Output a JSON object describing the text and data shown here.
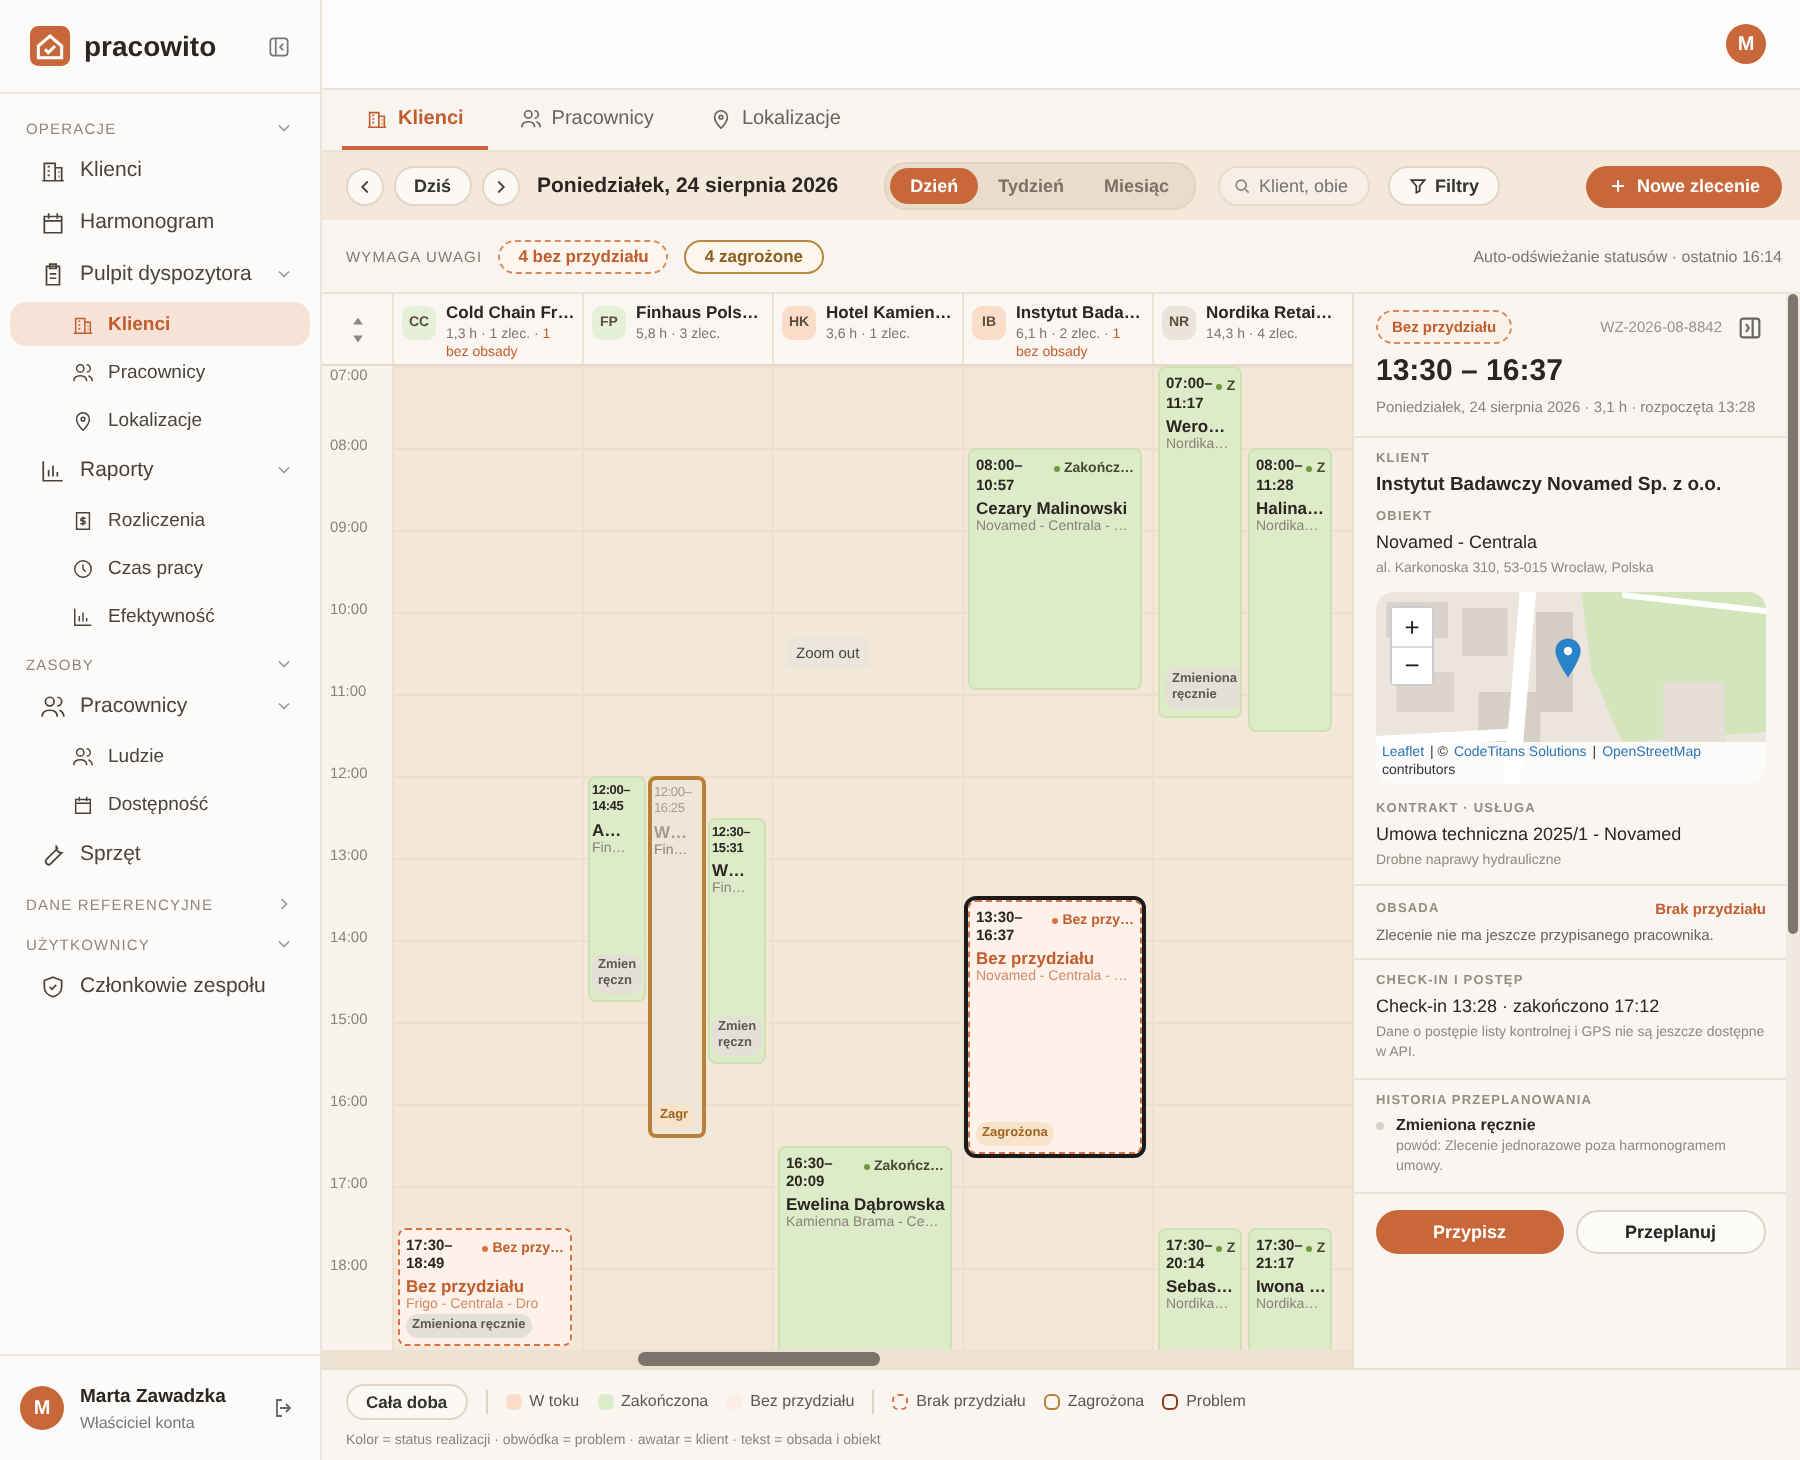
{
  "sidebar": {
    "logo": "pracowito",
    "sections": [
      {
        "title": "OPERACJE",
        "expanded": true,
        "items": [
          {
            "label": "Klienci",
            "kind": "building",
            "selected": false
          },
          {
            "label": "Harmonogram",
            "kind": "calendar",
            "selected": false
          },
          {
            "label": "Pulpit dyspozytora",
            "kind": "clipboard",
            "selected": false,
            "expanded": true,
            "children": [
              {
                "label": "Klienci",
                "kind": "building",
                "selected": true
              },
              {
                "label": "Pracownicy",
                "kind": "users",
                "selected": false
              },
              {
                "label": "Lokalizacje",
                "kind": "pin",
                "selected": false
              }
            ]
          },
          {
            "label": "Raporty",
            "kind": "chart",
            "selected": false,
            "expanded": true,
            "children": [
              {
                "label": "Rozliczenia",
                "kind": "invoice",
                "selected": false
              },
              {
                "label": "Czas pracy",
                "kind": "clock",
                "selected": false
              },
              {
                "label": "Efektywność",
                "kind": "chart",
                "selected": false
              }
            ]
          }
        ]
      },
      {
        "title": "ZASOBY",
        "expanded": true,
        "items": [
          {
            "label": "Pracownicy",
            "kind": "users",
            "selected": false,
            "expanded": true,
            "children": [
              {
                "label": "Ludzie",
                "kind": "users",
                "selected": false
              },
              {
                "label": "Dostępność",
                "kind": "calendar",
                "selected": false
              }
            ]
          },
          {
            "label": "Sprzęt",
            "kind": "wrench",
            "selected": false
          }
        ]
      },
      {
        "title": "DANE REFERENCYJNE",
        "expanded": false
      },
      {
        "title": "UŻYTKOWNICY",
        "expanded": true,
        "items": [
          {
            "label": "Członkowie zespołu",
            "kind": "shield",
            "selected": false
          }
        ]
      }
    ],
    "user": {
      "initial": "M",
      "name": "Marta Zawadzka",
      "role": "Właściciel konta"
    }
  },
  "topbar": {
    "avatar": "M"
  },
  "tabs": [
    {
      "label": "Klienci",
      "kind": "building",
      "selected": true
    },
    {
      "label": "Pracownicy",
      "kind": "users",
      "selected": false
    },
    {
      "label": "Lokalizacje",
      "kind": "pin",
      "selected": false
    }
  ],
  "toolbar": {
    "today": "Dziś",
    "date": "Poniedziałek, 24 sierpnia 2026",
    "views": [
      {
        "label": "Dzień",
        "selected": true
      },
      {
        "label": "Tydzień",
        "selected": false
      },
      {
        "label": "Miesiąc",
        "selected": false
      }
    ],
    "search": {
      "placeholder": "Klient, obie"
    },
    "filters": "Filtry",
    "new_order": "Nowe zlecenie"
  },
  "attention": {
    "label": "WYMAGA UWAGI",
    "chips": [
      {
        "label": "4 bez przydziału",
        "kind": "unassigned"
      },
      {
        "label": "4 zagrożone",
        "kind": "risk"
      }
    ],
    "refresh": "Auto-odświeżanie statusów · ostatnio 16:14"
  },
  "calendar": {
    "hours": [
      "07:00",
      "08:00",
      "09:00",
      "10:00",
      "11:00",
      "12:00",
      "13:00",
      "14:00",
      "15:00",
      "16:00",
      "17:00",
      "18:00"
    ],
    "tooltip": "Zoom out",
    "columns": [
      {
        "initials": "CC",
        "color": "#e6f0d6",
        "name": "Cold Chain Fr…",
        "meta": "1,3 h · 1 zlec. · ",
        "warning": "1 bez obsady",
        "events": [
          {
            "from": "17:30–",
            "to": "18:49",
            "kind": "unassigned",
            "selected": false,
            "tag": "Bez przy…",
            "title": "Bez przydziału",
            "sub": "Frigo - Centrala - Dro",
            "pill": {
              "label": "Zmieniona ręcznie",
              "kind": "manual"
            }
          }
        ]
      },
      {
        "initials": "FP",
        "color": "#e6f0d6",
        "name": "Finhaus Pols…",
        "meta": "5,8 h · 3 zlec.",
        "events": [
          {
            "from": "12:00–",
            "to": "14:45",
            "kind": "done",
            "selected": false,
            "title": "A…",
            "sub": "Fin…",
            "pill": {
              "label": "Zmien ręczn",
              "kind": "manual"
            }
          },
          {
            "from": "12:00–",
            "to": "16:25",
            "kind": "risk",
            "selected": false,
            "title": "W…",
            "sub": "Fin…",
            "pill": {
              "label": "Zagr",
              "kind": "risk"
            }
          },
          {
            "from": "12:30–",
            "to": "15:31",
            "kind": "done",
            "selected": false,
            "title": "W…",
            "sub": "Fin…",
            "pill": {
              "label": "Zmien ręczn",
              "kind": "manual"
            }
          }
        ]
      },
      {
        "initials": "HK",
        "color": "#fbdcc9",
        "name": "Hotel Kamien…",
        "meta": "3,6 h · 1 zlec.",
        "events": [
          {
            "from": "16:30–",
            "to": "20:09",
            "kind": "done",
            "selected": false,
            "tag": "Zakończ…",
            "title": "Ewelina Dąbrowska",
            "sub": "Kamienna Brama - Ce…"
          }
        ]
      },
      {
        "initials": "IB",
        "color": "#fbdcc9",
        "name": "Instytut Bada…",
        "meta": "6,1 h · 2 zlec. · ",
        "warning": "1 bez obsady",
        "events": [
          {
            "from": "08:00–",
            "to": "10:57",
            "kind": "done",
            "selected": false,
            "tag": "Zakończ…",
            "title": "Cezary Malinowski",
            "sub": "Novamed - Centrala - …"
          },
          {
            "from": "13:30–",
            "to": "16:37",
            "kind": "unassigned",
            "selected": true,
            "tag": "Bez przy…",
            "title": "Bez przydziału",
            "sub": "Novamed - Centrala - …",
            "pill": {
              "label": "Zagrożona",
              "kind": "risk"
            }
          }
        ]
      },
      {
        "initials": "NR",
        "color": "#ebe4da",
        "name": "Nordika Retai…",
        "meta": "14,3 h · 4 zlec.",
        "events": [
          {
            "from": "07:00–",
            "to": "11:17",
            "kind": "done",
            "selected": false,
            "tag": "Z",
            "title": "Wero…",
            "sub": "Nordika…",
            "pill": {
              "label": "Zmieniona ręcznie",
              "kind": "manual"
            }
          },
          {
            "from": "08:00–",
            "to": "11:28",
            "kind": "done",
            "selected": false,
            "tag": "Z",
            "title": "Halina…",
            "sub": "Nordika…"
          },
          {
            "from": "17:30–",
            "to": "20:14",
            "kind": "done",
            "selected": false,
            "tag": "Z",
            "title": "Sebas…",
            "sub": "Nordika…"
          },
          {
            "from": "17:30–",
            "to": "21:17",
            "kind": "done",
            "selected": false,
            "tag": "Z",
            "title": "Iwona …",
            "sub": "Nordika…"
          }
        ]
      }
    ]
  },
  "detail": {
    "status_chip": "Bez przydziału",
    "id": "WZ-2026-08-8842",
    "time": "13:30 – 16:37",
    "subtitle": "Poniedziałek, 24 sierpnia 2026 · 3,1 h · rozpoczęta 13:28",
    "client": {
      "label": "KLIENT",
      "value": "Instytut Badawczy Novamed Sp. z o.o."
    },
    "object": {
      "label": "OBIEKT",
      "value": "Novamed - Centrala",
      "address": "al. Karkonoska 310, 53-015 Wrocław, Polska"
    },
    "map": {
      "zoom_in": "+",
      "zoom_out": "−",
      "attribution": [
        {
          "text": "Leaflet",
          "link": true
        },
        {
          "text": "| ©",
          "link": false
        },
        {
          "text": "CodeTitans Solutions",
          "link": true
        },
        {
          "text": "|",
          "link": false
        },
        {
          "text": "OpenStreetMap",
          "link": true
        },
        {
          "text": "contributors",
          "link": false
        }
      ]
    },
    "contract": {
      "label": "KONTRAKT · USŁUGA",
      "value": "Umowa techniczna 2025/1 - Novamed",
      "note": "Drobne naprawy hydrauliczne"
    },
    "staff": {
      "label": "OBSADA",
      "status": "Brak przydziału",
      "text": "Zlecenie nie ma jeszcze przypisanego pracownika."
    },
    "checkin": {
      "label": "CHECK-IN I POSTĘP",
      "value": "Check-in 13:28 · zakończono 17:12",
      "note": "Dane o postępie listy kontrolnej i GPS nie są jeszcze dostępne w API."
    },
    "history": {
      "label": "HISTORIA PRZEPLANOWANIA",
      "items": [
        {
          "title": "Zmieniona ręcznie",
          "reason": "powód: Zlecenie jednorazowe poza harmonogramem umowy."
        }
      ]
    },
    "actions": [
      {
        "label": "Przypisz",
        "kind": "primary"
      },
      {
        "label": "Przeplanuj",
        "kind": "secondary"
      }
    ]
  },
  "footer": {
    "all_day": "Cała doba",
    "legend": [
      {
        "label": "W toku",
        "kind": "in_progress"
      },
      {
        "label": "Zakończona",
        "kind": "done"
      },
      {
        "label": "Bez przydziału",
        "kind": "unassigned"
      },
      {
        "label": "Brak przydziału",
        "kind": "dashed"
      },
      {
        "label": "Zagrożona",
        "kind": "risk"
      },
      {
        "label": "Problem",
        "kind": "problem"
      }
    ],
    "caption": "Kolor = status realizacji · obwódka = problem · awatar = klient · tekst = obsada i obiekt"
  }
}
